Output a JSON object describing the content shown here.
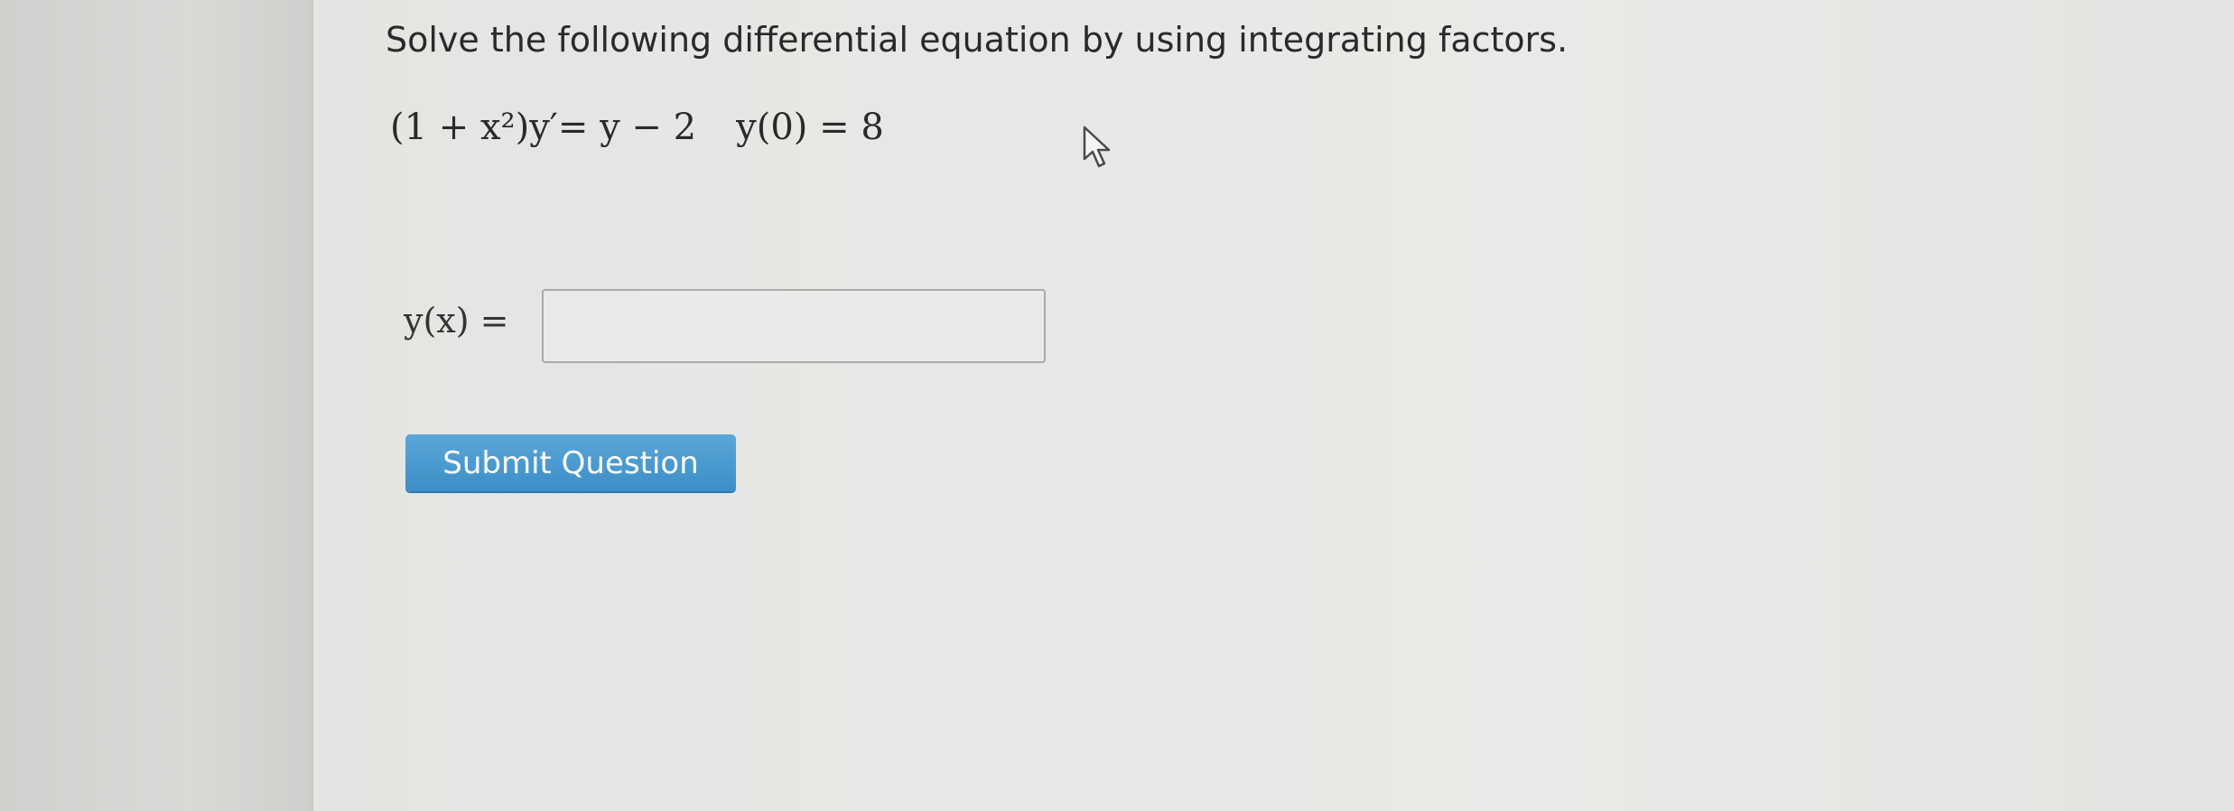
{
  "question": {
    "prompt": "Solve the following differential equation by using integrating factors.",
    "equation": "(1 + x²)y′= y − 2",
    "initial_condition": "y(0) = 8"
  },
  "answer": {
    "label": "y(x) =",
    "value": "",
    "placeholder": ""
  },
  "submit": {
    "label": "Submit Question"
  },
  "colors": {
    "button": "#4a9ad2",
    "text": "#2a2a2a"
  },
  "icons": {
    "cursor": "mouse-pointer-icon"
  }
}
